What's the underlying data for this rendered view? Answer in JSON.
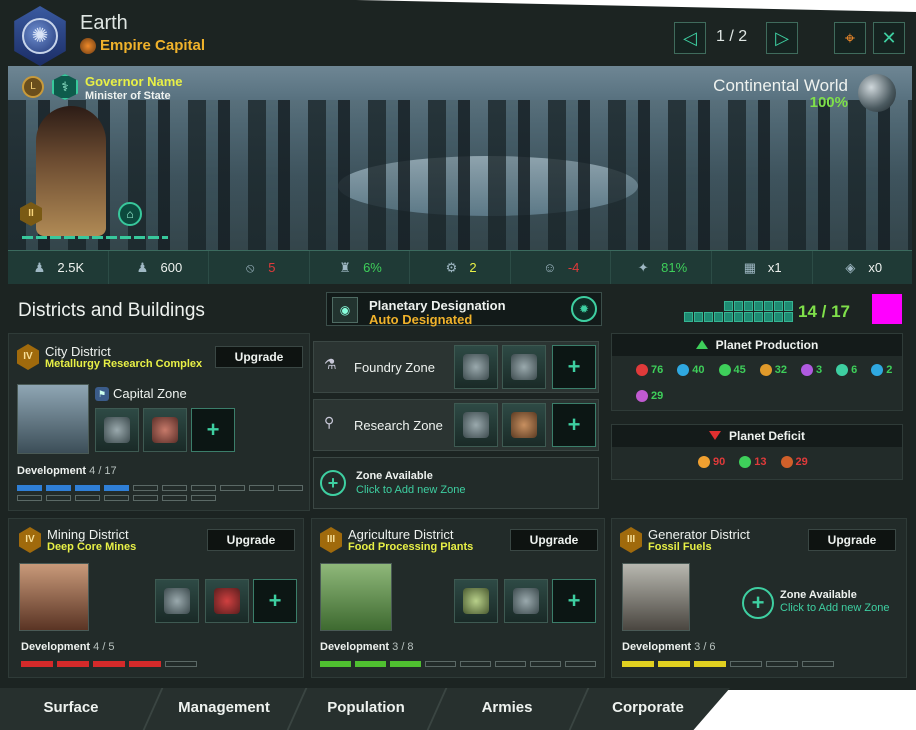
{
  "header": {
    "planet_name": "Earth",
    "capital_label": "Empire Capital",
    "pager": "1 / 2",
    "prev_icon": "◁",
    "next_icon": "▷",
    "close_icon": "✕",
    "camera_icon": "⌖"
  },
  "governor": {
    "name": "Governor Name",
    "title": "Minister of State",
    "level": "II",
    "medal": "L"
  },
  "world": {
    "type": "Continental World",
    "habitability": "100%"
  },
  "stats": [
    {
      "icon": "pop-icon",
      "glyph": "♟",
      "value": "2.5K",
      "color": "#eef2ef"
    },
    {
      "icon": "pop-growth-icon",
      "glyph": "♟",
      "value": "600",
      "color": "#eef2ef"
    },
    {
      "icon": "crime-icon",
      "glyph": "⦸",
      "value": "5",
      "color": "#e03a3a"
    },
    {
      "icon": "stability-icon",
      "glyph": "♜",
      "value": "6%",
      "color": "#3ecf5a"
    },
    {
      "icon": "jobs-icon",
      "glyph": "⚙",
      "value": "2",
      "color": "#e8f046"
    },
    {
      "icon": "amenities-icon",
      "glyph": "☺",
      "value": "-4",
      "color": "#e03a3a"
    },
    {
      "icon": "approval-icon",
      "glyph": "✦",
      "value": "81%",
      "color": "#3ecf5a"
    },
    {
      "icon": "devastation-icon",
      "glyph": "▦",
      "value": "x1",
      "color": "#eef2ef"
    },
    {
      "icon": "anomaly-icon",
      "glyph": "◈",
      "value": "x0",
      "color": "#eef2ef"
    }
  ],
  "section": {
    "title": "Districts and Buildings",
    "designation_label": "Planetary Designation",
    "designation_value": "Auto Designated",
    "slots": "14 / 17",
    "slots_used": 14,
    "slots_total": 17
  },
  "city": {
    "name": "City District",
    "spec": "Metallurgy Research Complex",
    "tier": "IV",
    "upgrade": "Upgrade",
    "capital_zone": "Capital Zone",
    "dev_label": "Development",
    "dev_value": "4 / 17",
    "dev_filled": 4,
    "dev_total": 17,
    "bar_color": "#2f7fd6"
  },
  "zones": [
    {
      "label": "Foundry Zone",
      "icon": "foundry-icon",
      "glyph": "⚗"
    },
    {
      "label": "Research Zone",
      "icon": "research-icon",
      "glyph": "⚲"
    }
  ],
  "zone_available": {
    "title": "Zone Available",
    "subtitle": "Click to Add new Zone",
    "plus": "+"
  },
  "mining": {
    "name": "Mining District",
    "spec": "Deep Core Mines",
    "tier": "IV",
    "upgrade": "Upgrade",
    "dev_label": "Development",
    "dev_value": "4 / 5",
    "dev_filled": 4,
    "dev_total": 5,
    "bar_color": "#d42a2a"
  },
  "agri": {
    "name": "Agriculture District",
    "spec": "Food Processing Plants",
    "tier": "III",
    "upgrade": "Upgrade",
    "dev_label": "Development",
    "dev_value": "3 / 8",
    "dev_filled": 3,
    "dev_total": 8,
    "bar_color": "#4fc030"
  },
  "gen": {
    "name": "Generator District",
    "spec": "Fossil Fuels",
    "tier": "III",
    "upgrade": "Upgrade",
    "dev_label": "Development",
    "dev_value": "3 / 6",
    "dev_filled": 3,
    "dev_total": 6,
    "bar_color": "#e0d020"
  },
  "production": {
    "title": "Planet Production",
    "items": [
      {
        "value": "76",
        "color": "#e03a3a"
      },
      {
        "value": "40",
        "color": "#2fa8e0"
      },
      {
        "value": "45",
        "color": "#3ecf5a"
      },
      {
        "value": "32",
        "color": "#e09a2a"
      },
      {
        "value": "3",
        "color": "#b05ae0"
      },
      {
        "value": "6",
        "color": "#3ecfa1"
      },
      {
        "value": "2",
        "color": "#2fa8e0"
      },
      {
        "value": "29",
        "color": "#c05ad0"
      }
    ]
  },
  "deficit": {
    "title": "Planet Deficit",
    "items": [
      {
        "value": "90",
        "color": "#f0a030"
      },
      {
        "value": "13",
        "color": "#3ecf5a"
      },
      {
        "value": "29",
        "color": "#d0602a"
      }
    ]
  },
  "tabs": [
    "Surface",
    "Management",
    "Population",
    "Armies",
    "Corporate"
  ],
  "add_glyph": "+"
}
